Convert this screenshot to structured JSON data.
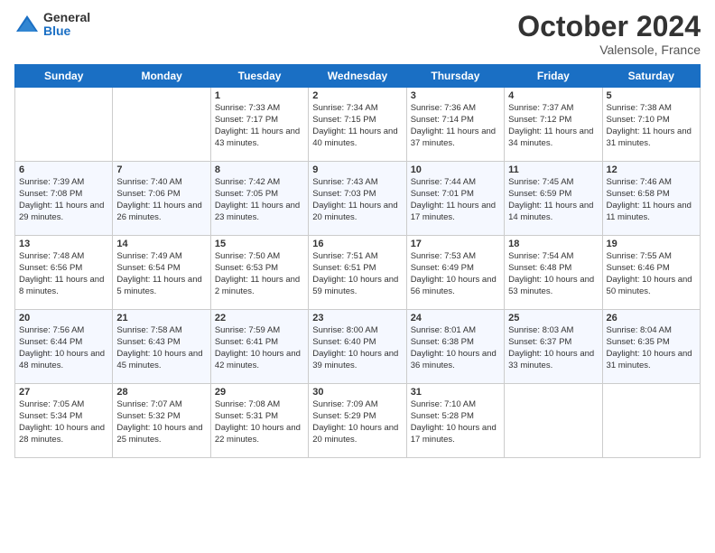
{
  "logo": {
    "general": "General",
    "blue": "Blue"
  },
  "title": "October 2024",
  "location": "Valensole, France",
  "days": [
    "Sunday",
    "Monday",
    "Tuesday",
    "Wednesday",
    "Thursday",
    "Friday",
    "Saturday"
  ],
  "weeks": [
    [
      {
        "num": "",
        "sunrise": "",
        "sunset": "",
        "daylight": ""
      },
      {
        "num": "",
        "sunrise": "",
        "sunset": "",
        "daylight": ""
      },
      {
        "num": "1",
        "sunrise": "Sunrise: 7:33 AM",
        "sunset": "Sunset: 7:17 PM",
        "daylight": "Daylight: 11 hours and 43 minutes."
      },
      {
        "num": "2",
        "sunrise": "Sunrise: 7:34 AM",
        "sunset": "Sunset: 7:15 PM",
        "daylight": "Daylight: 11 hours and 40 minutes."
      },
      {
        "num": "3",
        "sunrise": "Sunrise: 7:36 AM",
        "sunset": "Sunset: 7:14 PM",
        "daylight": "Daylight: 11 hours and 37 minutes."
      },
      {
        "num": "4",
        "sunrise": "Sunrise: 7:37 AM",
        "sunset": "Sunset: 7:12 PM",
        "daylight": "Daylight: 11 hours and 34 minutes."
      },
      {
        "num": "5",
        "sunrise": "Sunrise: 7:38 AM",
        "sunset": "Sunset: 7:10 PM",
        "daylight": "Daylight: 11 hours and 31 minutes."
      }
    ],
    [
      {
        "num": "6",
        "sunrise": "Sunrise: 7:39 AM",
        "sunset": "Sunset: 7:08 PM",
        "daylight": "Daylight: 11 hours and 29 minutes."
      },
      {
        "num": "7",
        "sunrise": "Sunrise: 7:40 AM",
        "sunset": "Sunset: 7:06 PM",
        "daylight": "Daylight: 11 hours and 26 minutes."
      },
      {
        "num": "8",
        "sunrise": "Sunrise: 7:42 AM",
        "sunset": "Sunset: 7:05 PM",
        "daylight": "Daylight: 11 hours and 23 minutes."
      },
      {
        "num": "9",
        "sunrise": "Sunrise: 7:43 AM",
        "sunset": "Sunset: 7:03 PM",
        "daylight": "Daylight: 11 hours and 20 minutes."
      },
      {
        "num": "10",
        "sunrise": "Sunrise: 7:44 AM",
        "sunset": "Sunset: 7:01 PM",
        "daylight": "Daylight: 11 hours and 17 minutes."
      },
      {
        "num": "11",
        "sunrise": "Sunrise: 7:45 AM",
        "sunset": "Sunset: 6:59 PM",
        "daylight": "Daylight: 11 hours and 14 minutes."
      },
      {
        "num": "12",
        "sunrise": "Sunrise: 7:46 AM",
        "sunset": "Sunset: 6:58 PM",
        "daylight": "Daylight: 11 hours and 11 minutes."
      }
    ],
    [
      {
        "num": "13",
        "sunrise": "Sunrise: 7:48 AM",
        "sunset": "Sunset: 6:56 PM",
        "daylight": "Daylight: 11 hours and 8 minutes."
      },
      {
        "num": "14",
        "sunrise": "Sunrise: 7:49 AM",
        "sunset": "Sunset: 6:54 PM",
        "daylight": "Daylight: 11 hours and 5 minutes."
      },
      {
        "num": "15",
        "sunrise": "Sunrise: 7:50 AM",
        "sunset": "Sunset: 6:53 PM",
        "daylight": "Daylight: 11 hours and 2 minutes."
      },
      {
        "num": "16",
        "sunrise": "Sunrise: 7:51 AM",
        "sunset": "Sunset: 6:51 PM",
        "daylight": "Daylight: 10 hours and 59 minutes."
      },
      {
        "num": "17",
        "sunrise": "Sunrise: 7:53 AM",
        "sunset": "Sunset: 6:49 PM",
        "daylight": "Daylight: 10 hours and 56 minutes."
      },
      {
        "num": "18",
        "sunrise": "Sunrise: 7:54 AM",
        "sunset": "Sunset: 6:48 PM",
        "daylight": "Daylight: 10 hours and 53 minutes."
      },
      {
        "num": "19",
        "sunrise": "Sunrise: 7:55 AM",
        "sunset": "Sunset: 6:46 PM",
        "daylight": "Daylight: 10 hours and 50 minutes."
      }
    ],
    [
      {
        "num": "20",
        "sunrise": "Sunrise: 7:56 AM",
        "sunset": "Sunset: 6:44 PM",
        "daylight": "Daylight: 10 hours and 48 minutes."
      },
      {
        "num": "21",
        "sunrise": "Sunrise: 7:58 AM",
        "sunset": "Sunset: 6:43 PM",
        "daylight": "Daylight: 10 hours and 45 minutes."
      },
      {
        "num": "22",
        "sunrise": "Sunrise: 7:59 AM",
        "sunset": "Sunset: 6:41 PM",
        "daylight": "Daylight: 10 hours and 42 minutes."
      },
      {
        "num": "23",
        "sunrise": "Sunrise: 8:00 AM",
        "sunset": "Sunset: 6:40 PM",
        "daylight": "Daylight: 10 hours and 39 minutes."
      },
      {
        "num": "24",
        "sunrise": "Sunrise: 8:01 AM",
        "sunset": "Sunset: 6:38 PM",
        "daylight": "Daylight: 10 hours and 36 minutes."
      },
      {
        "num": "25",
        "sunrise": "Sunrise: 8:03 AM",
        "sunset": "Sunset: 6:37 PM",
        "daylight": "Daylight: 10 hours and 33 minutes."
      },
      {
        "num": "26",
        "sunrise": "Sunrise: 8:04 AM",
        "sunset": "Sunset: 6:35 PM",
        "daylight": "Daylight: 10 hours and 31 minutes."
      }
    ],
    [
      {
        "num": "27",
        "sunrise": "Sunrise: 7:05 AM",
        "sunset": "Sunset: 5:34 PM",
        "daylight": "Daylight: 10 hours and 28 minutes."
      },
      {
        "num": "28",
        "sunrise": "Sunrise: 7:07 AM",
        "sunset": "Sunset: 5:32 PM",
        "daylight": "Daylight: 10 hours and 25 minutes."
      },
      {
        "num": "29",
        "sunrise": "Sunrise: 7:08 AM",
        "sunset": "Sunset: 5:31 PM",
        "daylight": "Daylight: 10 hours and 22 minutes."
      },
      {
        "num": "30",
        "sunrise": "Sunrise: 7:09 AM",
        "sunset": "Sunset: 5:29 PM",
        "daylight": "Daylight: 10 hours and 20 minutes."
      },
      {
        "num": "31",
        "sunrise": "Sunrise: 7:10 AM",
        "sunset": "Sunset: 5:28 PM",
        "daylight": "Daylight: 10 hours and 17 minutes."
      },
      {
        "num": "",
        "sunrise": "",
        "sunset": "",
        "daylight": ""
      },
      {
        "num": "",
        "sunrise": "",
        "sunset": "",
        "daylight": ""
      }
    ]
  ]
}
